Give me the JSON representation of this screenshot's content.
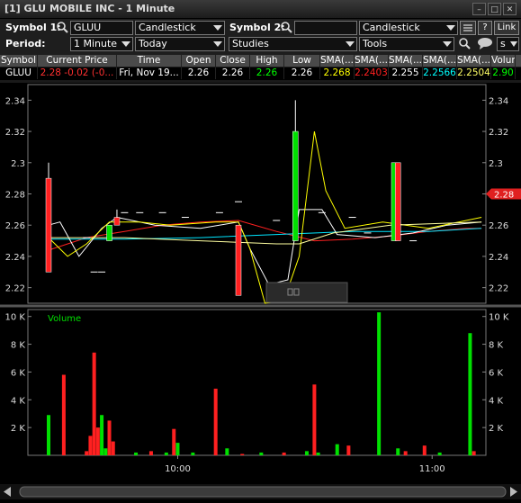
{
  "window": {
    "title": "[1] GLU MOBILE INC - 1 Minute"
  },
  "toolbar": {
    "symbol1_label": "Symbol 1:",
    "symbol1_value": "GLUU",
    "chart_type1": "Candlestick",
    "symbol2_label": "Symbol 2:",
    "symbol2_value": "",
    "chart_type2": "Candlestick",
    "period_label": "Period:",
    "period_value": "1 Minute",
    "range_value": "Today",
    "studies_label": "Studies",
    "tools_label": "Tools",
    "help_label": "?",
    "link_label": "Link",
    "s_label": "s"
  },
  "quote": {
    "headers": [
      "Symbol",
      "Current Price",
      "Time",
      "Open",
      "Close",
      "High",
      "Low",
      "SMA(...",
      "SMA(...",
      "SMA(...",
      "SMA(...",
      "SMA(...",
      "Volum"
    ],
    "row": [
      "GLUU",
      "2.28 -0.02 (-0...",
      "Fri, Nov 19...",
      "2.26",
      "2.26",
      "2.26",
      "2.26",
      "2.268",
      "2.2403",
      "2.255",
      "2.2566",
      "2.2504",
      "2.90"
    ],
    "colors": [
      "#ffffff",
      "#ff3030",
      "#ffffff",
      "#ffffff",
      "#ffffff",
      "#00ff00",
      "#ffffff",
      "#ffff00",
      "#ff2020",
      "#ffffff",
      "#00ffff",
      "#ffff66",
      "#00ff00"
    ]
  },
  "chart_data": [
    {
      "type": "candlestick",
      "price_axis_ticks": [
        "2.34",
        "2.32",
        "2.3",
        "2.28",
        "2.26",
        "2.24",
        "2.22"
      ],
      "ylim": [
        2.21,
        2.35
      ],
      "last_price_label": "2.28",
      "candles": [
        {
          "t": 0,
          "o": 2.29,
          "c": 2.23,
          "h": 2.3,
          "l": 2.23,
          "up": false
        },
        {
          "t": 16,
          "o": 2.25,
          "c": 2.26,
          "h": 2.26,
          "l": 2.25,
          "up": true
        },
        {
          "t": 18,
          "o": 2.265,
          "c": 2.26,
          "h": 2.27,
          "l": 2.26,
          "up": false
        },
        {
          "t": 50,
          "o": 2.26,
          "c": 2.215,
          "h": 2.26,
          "l": 2.215,
          "up": false
        },
        {
          "t": 65,
          "o": 2.25,
          "c": 2.32,
          "h": 2.34,
          "l": 2.25,
          "up": true
        },
        {
          "t": 91,
          "o": 2.25,
          "c": 2.3,
          "h": 2.3,
          "l": 2.25,
          "up": true
        },
        {
          "t": 92,
          "o": 2.3,
          "c": 2.25,
          "h": 2.3,
          "l": 2.25,
          "up": false
        }
      ]
    },
    {
      "type": "bar",
      "title": "Volume",
      "volume_axis_ticks": [
        "10 K",
        "8 K",
        "6 K",
        "4 K",
        "2 K"
      ],
      "ylim": [
        0,
        10500
      ],
      "x_ticks": [
        "10:00",
        "11:00"
      ],
      "bars": [
        {
          "t": 0,
          "v": 2900,
          "up": true
        },
        {
          "t": 4,
          "v": 5800,
          "up": false
        },
        {
          "t": 10,
          "v": 300,
          "up": false
        },
        {
          "t": 11,
          "v": 1400,
          "up": false
        },
        {
          "t": 12,
          "v": 7400,
          "up": false
        },
        {
          "t": 13,
          "v": 2000,
          "up": false
        },
        {
          "t": 14,
          "v": 2900,
          "up": true
        },
        {
          "t": 15,
          "v": 500,
          "up": true
        },
        {
          "t": 16,
          "v": 2500,
          "up": false
        },
        {
          "t": 17,
          "v": 1000,
          "up": false
        },
        {
          "t": 23,
          "v": 200,
          "up": true
        },
        {
          "t": 27,
          "v": 300,
          "up": false
        },
        {
          "t": 31,
          "v": 200,
          "up": true
        },
        {
          "t": 33,
          "v": 1900,
          "up": false
        },
        {
          "t": 34,
          "v": 900,
          "up": true
        },
        {
          "t": 38,
          "v": 200,
          "up": true
        },
        {
          "t": 44,
          "v": 4800,
          "up": false
        },
        {
          "t": 47,
          "v": 500,
          "up": true
        },
        {
          "t": 51,
          "v": 100,
          "up": false
        },
        {
          "t": 56,
          "v": 200,
          "up": true
        },
        {
          "t": 62,
          "v": 200,
          "up": false
        },
        {
          "t": 68,
          "v": 300,
          "up": true
        },
        {
          "t": 70,
          "v": 5100,
          "up": false
        },
        {
          "t": 71,
          "v": 200,
          "up": true
        },
        {
          "t": 76,
          "v": 800,
          "up": true
        },
        {
          "t": 79,
          "v": 700,
          "up": false
        },
        {
          "t": 87,
          "v": 10300,
          "up": true
        },
        {
          "t": 92,
          "v": 500,
          "up": true
        },
        {
          "t": 94,
          "v": 300,
          "up": false
        },
        {
          "t": 99,
          "v": 700,
          "up": false
        },
        {
          "t": 103,
          "v": 200,
          "up": true
        },
        {
          "t": 111,
          "v": 8800,
          "up": true
        },
        {
          "t": 112,
          "v": 300,
          "up": false
        }
      ]
    }
  ]
}
